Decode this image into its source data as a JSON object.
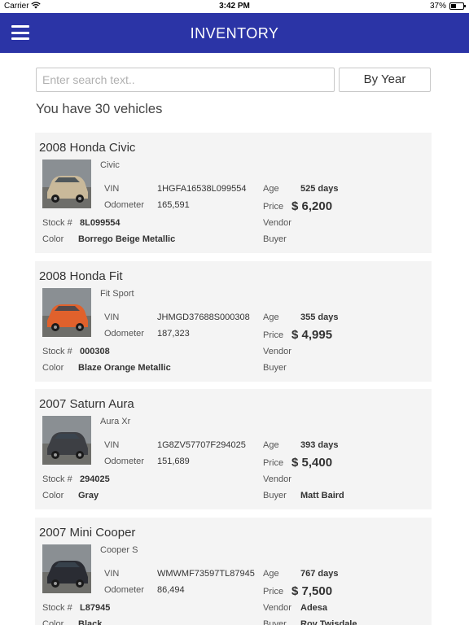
{
  "status_bar": {
    "carrier": "Carrier",
    "time": "3:42 PM",
    "battery_text": "37%",
    "battery_level": 0.37
  },
  "nav": {
    "title": "INVENTORY"
  },
  "search": {
    "placeholder": "Enter search text..",
    "value": "",
    "sort_label": "By Year"
  },
  "summary": {
    "count_text": "You have 30 vehicles"
  },
  "labels": {
    "vin": "VIN",
    "odometer": "Odometer",
    "stock": "Stock #",
    "color": "Color",
    "age": "Age",
    "price": "Price",
    "vendor": "Vendor",
    "buyer": "Buyer"
  },
  "vehicles": [
    {
      "title": "2008 Honda Civic",
      "trim": "Civic",
      "vin": "1HGFA16538L099554",
      "odometer": "165,591",
      "stock": "8L099554",
      "color": "Borrego Beige Metallic",
      "age": "525 days",
      "price": "$ 6,200",
      "vendor": "",
      "buyer": "",
      "body_color": "#c9b99a"
    },
    {
      "title": "2008 Honda Fit",
      "trim": "Fit Sport",
      "vin": "JHMGD37688S000308",
      "odometer": "187,323",
      "stock": "000308",
      "color": "Blaze Orange Metallic",
      "age": "355 days",
      "price": "$ 4,995",
      "vendor": "",
      "buyer": "",
      "body_color": "#e0612c"
    },
    {
      "title": "2007 Saturn Aura",
      "trim": "Aura Xr",
      "vin": "1G8ZV57707F294025",
      "odometer": "151,689",
      "stock": "294025",
      "color": "Gray",
      "age": "393 days",
      "price": "$ 5,400",
      "vendor": "",
      "buyer": "Matt Baird",
      "body_color": "#3d3f44"
    },
    {
      "title": "2007 Mini Cooper",
      "trim": "Cooper S",
      "vin": "WMWMF73597TL87945",
      "odometer": "86,494",
      "stock": "L87945",
      "color": "Black",
      "age": "767 days",
      "price": "$ 7,500",
      "vendor": "Adesa",
      "buyer": "Roy Twisdale",
      "body_color": "#2a2c33"
    }
  ]
}
